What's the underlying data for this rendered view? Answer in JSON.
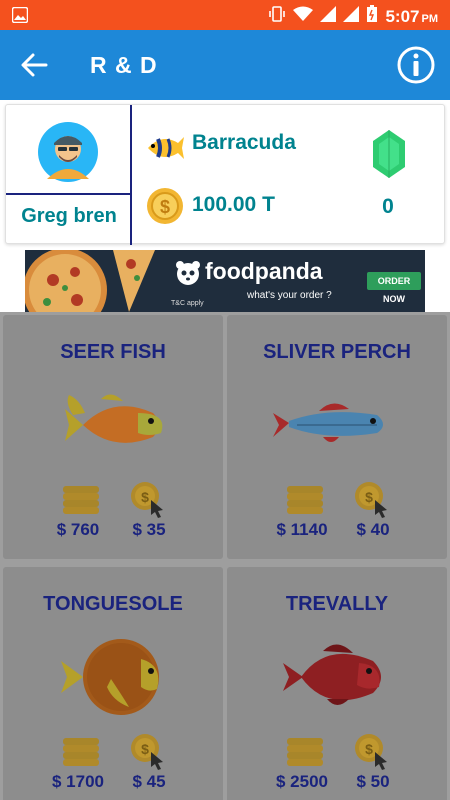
{
  "status_bar": {
    "time": "5:07",
    "ampm": "PM"
  },
  "app_bar": {
    "title": "R & D"
  },
  "profile": {
    "player_name": "Greg bren",
    "boat_name": "Barracuda",
    "balance": "100.00 T",
    "gems": "0"
  },
  "ad": {
    "brand": "foodpanda",
    "tagline": "what's your order ?",
    "tc": "T&C apply",
    "cta": "ORDER NOW"
  },
  "fish": [
    {
      "name": "SEER FISH",
      "price": "$ 760",
      "per_click": "$ 35",
      "color": "#c77a2c"
    },
    {
      "name": "SLIVER PERCH",
      "price": "$ 1140",
      "per_click": "$ 40",
      "color": "#3f7aa6"
    },
    {
      "name": "TONGUESOLE",
      "price": "$ 1700",
      "per_click": "$ 45",
      "color": "#a35a1a"
    },
    {
      "name": "TREVALLY",
      "price": "$ 2500",
      "per_click": "$ 50",
      "color": "#8e1f22"
    }
  ],
  "colors": {
    "status_bar": "#f4511e",
    "app_bar": "#1e88d8",
    "accent_text": "#00838f",
    "card_title": "#1a237e"
  }
}
